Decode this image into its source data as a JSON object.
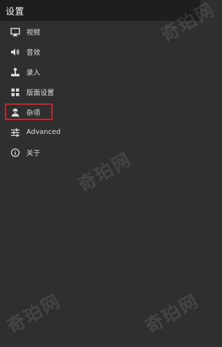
{
  "header": {
    "title": "设置"
  },
  "menu": {
    "items": [
      {
        "label": "视频",
        "icon": "monitor-icon"
      },
      {
        "label": "音效",
        "icon": "speaker-icon"
      },
      {
        "label": "录入",
        "icon": "joystick-icon"
      },
      {
        "label": "版面设置",
        "icon": "grid-icon"
      },
      {
        "label": "杂项",
        "icon": "user-icon",
        "highlighted": true
      },
      {
        "label": "Advanced",
        "icon": "sliders-icon"
      },
      {
        "label": "关于",
        "icon": "info-icon"
      }
    ]
  },
  "watermark": {
    "text": "奇珀网"
  },
  "colors": {
    "background": "#2f2f2f",
    "header": "#1e1e1e",
    "highlight_border": "#c0282b"
  }
}
